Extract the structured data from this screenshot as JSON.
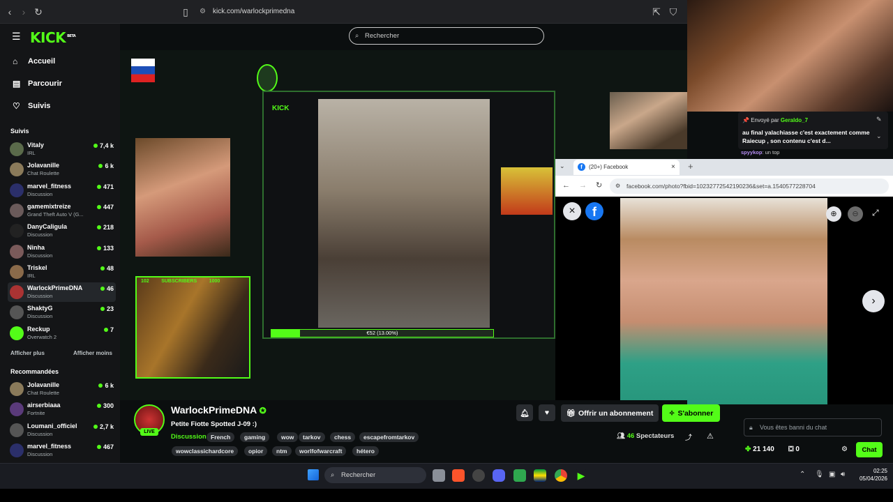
{
  "browser": {
    "url": "kick.com/warlockprimedna"
  },
  "site": {
    "logo": "KICK",
    "logo_beta": "BETA",
    "search_placeholder": "Rechercher",
    "nav": [
      {
        "label": "Accueil",
        "icon": "home-icon"
      },
      {
        "label": "Parcourir",
        "icon": "browse-icon"
      },
      {
        "label": "Suivis",
        "icon": "heart-icon"
      }
    ],
    "followed_heading": "Suivis",
    "followed": [
      {
        "name": "Vitaly",
        "category": "IRL",
        "viewers": "7,4 k",
        "color": "#5a6a4a"
      },
      {
        "name": "Jolavanille",
        "category": "Chat Roulette",
        "viewers": "6 k",
        "color": "#8a7a5a"
      },
      {
        "name": "marvel_fitness",
        "category": "Discussion",
        "viewers": "471",
        "color": "#2b2f6a"
      },
      {
        "name": "gamemixtreize",
        "category": "Grand Theft Auto V (G...",
        "viewers": "447",
        "color": "#6a5a5a"
      },
      {
        "name": "DanyCaligula",
        "category": "Discussion",
        "viewers": "218",
        "color": "#222"
      },
      {
        "name": "Ninha",
        "category": "Discussion",
        "viewers": "133",
        "color": "#7a5a5a"
      },
      {
        "name": "Triskel",
        "category": "IRL",
        "viewers": "48",
        "color": "#8a6a4a"
      },
      {
        "name": "WarlockPrimeDNA",
        "category": "Discussion",
        "viewers": "46",
        "color": "#a33"
      },
      {
        "name": "ShaktyG",
        "category": "Discussion",
        "viewers": "23",
        "color": "#555"
      },
      {
        "name": "Reckup",
        "category": "Overwatch 2",
        "viewers": "7",
        "color": "#53fc18"
      }
    ],
    "show_more": "Afficher plus",
    "show_less": "Afficher moins",
    "recommended_heading": "Recommandées",
    "recommended": [
      {
        "name": "Jolavanille",
        "category": "Chat Roulette",
        "viewers": "6 k",
        "color": "#8a7a5a"
      },
      {
        "name": "airserbiaaa",
        "category": "Fortnite",
        "viewers": "300",
        "color": "#5a3a7a"
      },
      {
        "name": "Loumani_officiel",
        "category": "Discussion",
        "viewers": "2,7 k",
        "color": "#555"
      },
      {
        "name": "marvel_fitness",
        "category": "Discussion",
        "viewers": "467",
        "color": "#2b2f6a"
      }
    ]
  },
  "stream": {
    "streamer": "WarlockPrimeDNA",
    "title": "Petite Fiotte Spotted J-09 :)",
    "live_badge": "LIVE",
    "category": "Discussion",
    "tags": [
      "French",
      "gaming",
      "wow",
      "tarkov",
      "chess",
      "escapefromtarkov",
      "wowclassichardcore",
      "opior",
      "ntm",
      "worlfofwarcraft",
      "hétero"
    ],
    "subscribe_gift": "Offrir un abonnement",
    "subscribe": "S'abonner",
    "viewers_count": "46",
    "viewers_label": "Spectateurs",
    "donation_bar": "€52 (13.00%)",
    "overlay_labels": [
      "102",
      "SUBSCRIBERS",
      "1000"
    ]
  },
  "chat": {
    "pinned_prefix": "Envoyé par",
    "pinned_user": "Geraldo_7",
    "pinned_message": "au final yalachiasse c'est exactement comme Raiecup , son contenu c'est d...",
    "partial_line_user": "spyykop",
    "partial_line_text": ": un top",
    "banned_placeholder": "Vous êtes banni du chat",
    "points": "21 140",
    "gifts": "0",
    "chat_button": "Chat"
  },
  "facebook_window": {
    "tab_title": "(20+) Facebook",
    "url": "facebook.com/photo?fbid=10232772542190236&set=a.1540577228704"
  },
  "taskbar": {
    "search": "Rechercher",
    "time": "02:25",
    "date": "05/04/2026"
  }
}
